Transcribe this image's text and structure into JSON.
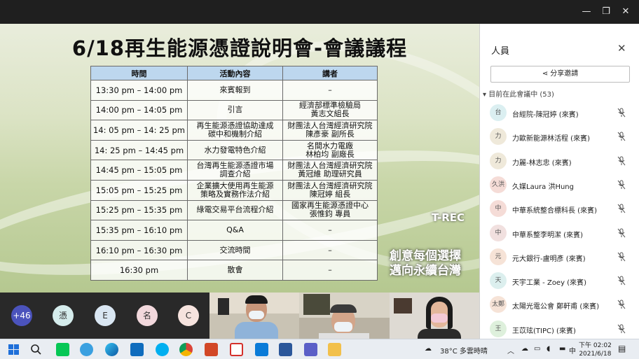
{
  "window": {
    "minimize_glyph": "—",
    "restore_glyph": "❐",
    "close_glyph": "✕"
  },
  "slide": {
    "title": "6/18再生能源憑證說明會-會議議程",
    "headers": [
      "時間",
      "活動內容",
      "講者"
    ],
    "rows": [
      {
        "time": "13:30 pm – 14:00 pm",
        "activity": "來賓報到",
        "speaker": "–"
      },
      {
        "time": "14:00 pm – 14:05 pm",
        "activity": "引言",
        "speaker": "經濟部標準檢驗局\n黃志文組長"
      },
      {
        "time": "14: 05 pm – 14: 25 pm",
        "activity": "再生能源憑證協助達成\n碳中和機制介紹",
        "speaker": "財團法人台灣經濟研究院\n陳彥豪 副所長"
      },
      {
        "time": "14: 25 pm – 14:45 pm",
        "activity": "水力發電特色介紹",
        "speaker": "名間水力電廠\n林柏均 副廠長"
      },
      {
        "time": "14:45 pm – 15:05 pm",
        "activity": "台灣再生能源憑證市場\n調查介紹",
        "speaker": "財團法人台灣經濟研究院\n黃冠維 助理研究員"
      },
      {
        "time": "15:05 pm – 15:25 pm",
        "activity": "企業擴大使用再生能源\n策略及實務作法介紹",
        "speaker": "財團法人台灣經濟研究院\n陳冠婷 組長"
      },
      {
        "time": "15:25 pm – 15:35 pm",
        "activity": "綠電交易平台流程介紹",
        "speaker": "國家再生能源憑證中心\n張惟鈞 專員"
      },
      {
        "time": "15:35 pm – 16:10 pm",
        "activity": "Q&A",
        "speaker": "–"
      },
      {
        "time": "16:10 pm – 16:30 pm",
        "activity": "交流時間",
        "speaker": "–"
      },
      {
        "time": "16:30 pm",
        "activity": "散會",
        "speaker": "–"
      }
    ],
    "logo_text": "T-REC",
    "slogan_line1": "創意每個選擇",
    "slogan_line2": "邁向永續台灣"
  },
  "strip": {
    "overflow_count": "+46",
    "avatars": [
      {
        "initial": "憑",
        "bg": "#d5ecec",
        "fg": "#333"
      },
      {
        "initial": "E",
        "bg": "#d9e6f2",
        "fg": "#333"
      },
      {
        "initial": "名",
        "bg": "#f2d8dc",
        "fg": "#333"
      },
      {
        "initial": "C",
        "bg": "#f6e3de",
        "fg": "#333"
      }
    ]
  },
  "panel": {
    "title": "人員",
    "share_label": "分享邀請",
    "section_label": "目前在此會議中 (53)",
    "participants": [
      {
        "initial": "台",
        "name": "台經院-陳冠婷 (來賓)",
        "bg": "#dbeff1"
      },
      {
        "initial": "力",
        "name": "力歐新能源林活程 (來賓)",
        "bg": "#efe9da"
      },
      {
        "initial": "力",
        "name": "力麗-林志忠 (來賓)",
        "bg": "#efe9da"
      },
      {
        "initial": "久洪",
        "name": "久媒Laura 洪Hung",
        "bg": "#f5dcd7"
      },
      {
        "initial": "中",
        "name": "中華系統整合標科長 (來賓)",
        "bg": "#f5dcd7"
      },
      {
        "initial": "中",
        "name": "中華系整李明潔 (來賓)",
        "bg": "#f1e0df"
      },
      {
        "initial": "元",
        "name": "元大銀行-盧明彥 (來賓)",
        "bg": "#f6e3d7"
      },
      {
        "initial": "天",
        "name": "天宇工業 - Zoey (來賓)",
        "bg": "#dcefee"
      },
      {
        "initial": "太鄭",
        "name": "太陽光電公會 鄭軒甫 (來賓)",
        "bg": "#f6e3d7"
      },
      {
        "initial": "王",
        "name": "王苡玹(TIPC) (來賓)",
        "bg": "#def0dc"
      }
    ]
  },
  "taskbar": {
    "weather": "38°C  多雲時晴",
    "ime": "中",
    "time": "下午 02:02",
    "date": "2021/6/18"
  }
}
